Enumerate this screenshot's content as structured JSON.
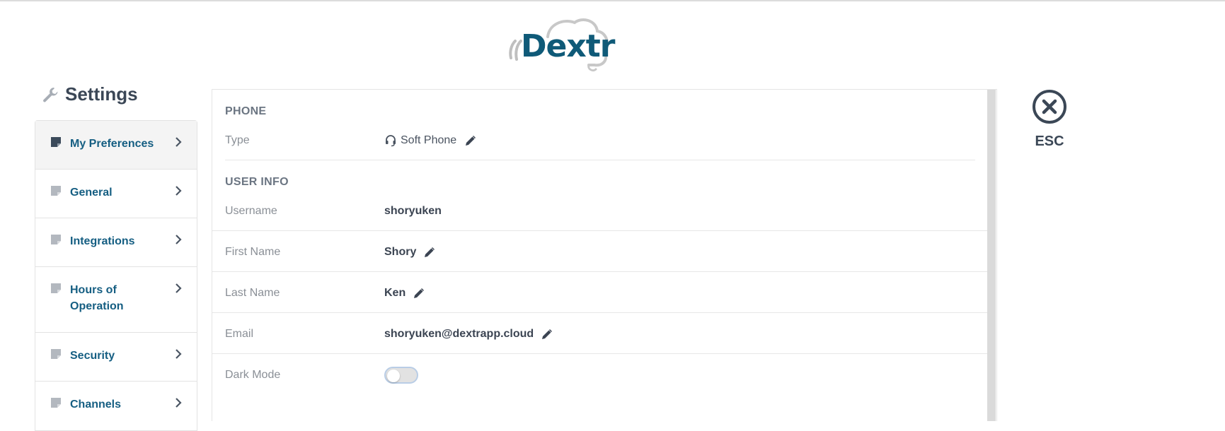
{
  "brand": {
    "logo_text": "Dextr"
  },
  "settings": {
    "title": "Settings"
  },
  "sidebar": {
    "items": [
      {
        "label": "My Preferences"
      },
      {
        "label": "General"
      },
      {
        "label": "Integrations"
      },
      {
        "label": "Hours of Operation"
      },
      {
        "label": "Security"
      },
      {
        "label": "Channels"
      }
    ]
  },
  "phone": {
    "section_title": "PHONE",
    "type_label": "Type",
    "type_value": "Soft Phone"
  },
  "user_info": {
    "section_title": "USER INFO",
    "username_label": "Username",
    "username_value": "shoryuken",
    "first_name_label": "First Name",
    "first_name_value": "Shory",
    "last_name_label": "Last Name",
    "last_name_value": "Ken",
    "email_label": "Email",
    "email_value": "shoryuken@dextrapp.cloud",
    "dark_mode_label": "Dark Mode",
    "dark_mode_on": false
  },
  "esc": {
    "label": "ESC"
  },
  "colors": {
    "accent": "#155e82",
    "text": "#3b4756",
    "muted": "#8a8f96"
  }
}
